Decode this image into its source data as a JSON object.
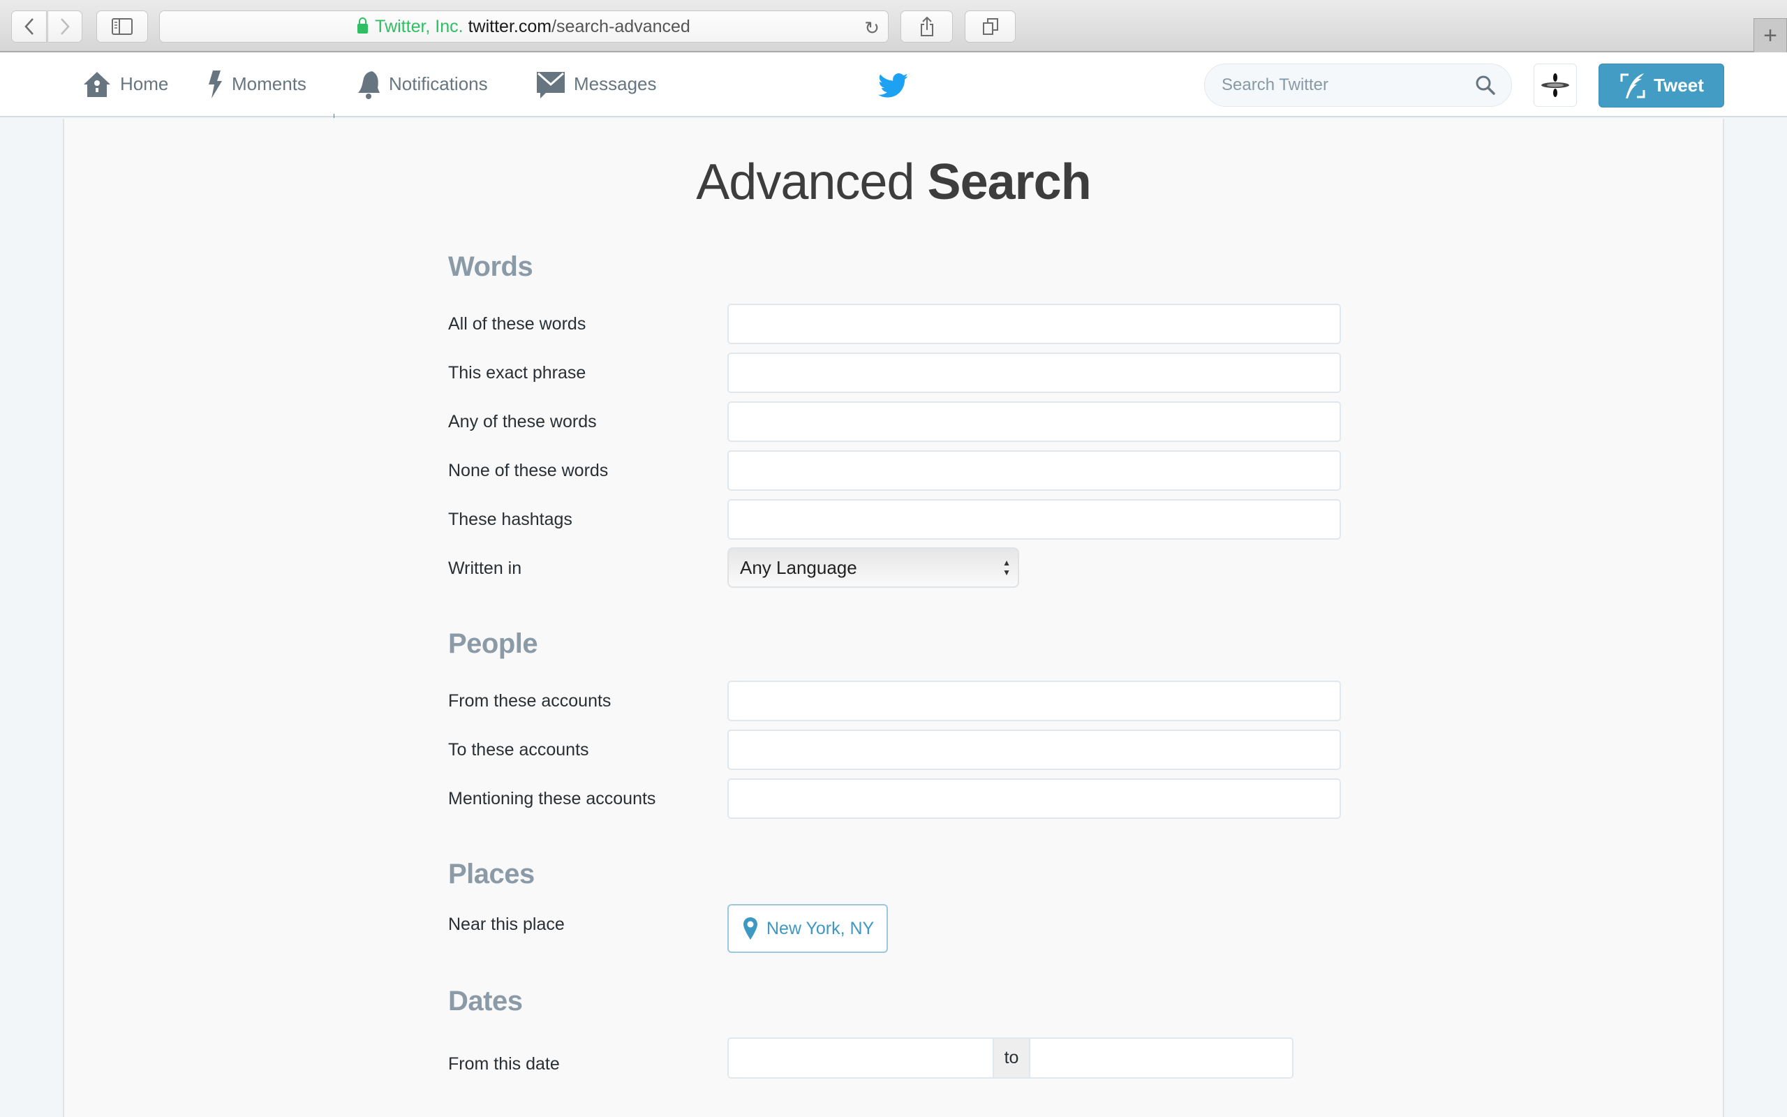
{
  "browser": {
    "address": {
      "org": "Twitter, Inc.",
      "host": "twitter.com",
      "path": "/search-advanced"
    },
    "icons": {
      "back": "chevron-left-icon",
      "forward": "chevron-right-icon",
      "sidebar": "sidebar-icon",
      "reload": "reload-icon",
      "share": "share-icon",
      "tabs": "tabs-icon",
      "new_tab": "plus-icon"
    },
    "reload_glyph": "↻",
    "new_tab_glyph": "+"
  },
  "nav": {
    "items": [
      {
        "label": "Home",
        "icon": "home-icon"
      },
      {
        "label": "Moments",
        "icon": "lightning-icon"
      },
      {
        "label": "Notifications",
        "icon": "bell-icon"
      },
      {
        "label": "Messages",
        "icon": "envelope-icon"
      }
    ],
    "logo": "twitter-bird-icon",
    "search_placeholder": "Search Twitter",
    "tweet_label": "Tweet",
    "colors": {
      "bird": "#1da1f2",
      "tweet_button": "#429cc4",
      "nav_text": "#66757f"
    }
  },
  "page": {
    "title_light": "Advanced",
    "title_bold": "Search",
    "sections": {
      "words": {
        "heading": "Words",
        "fields": [
          {
            "label": "All of these words",
            "value": ""
          },
          {
            "label": "This exact phrase",
            "value": ""
          },
          {
            "label": "Any of these words",
            "value": ""
          },
          {
            "label": "None of these words",
            "value": ""
          },
          {
            "label": "These hashtags",
            "value": ""
          }
        ],
        "language_label": "Written in",
        "language_selected": "Any Language"
      },
      "people": {
        "heading": "People",
        "fields": [
          {
            "label": "From these accounts",
            "value": ""
          },
          {
            "label": "To these accounts",
            "value": ""
          },
          {
            "label": "Mentioning these accounts",
            "value": ""
          }
        ]
      },
      "places": {
        "heading": "Places",
        "near_label": "Near this place",
        "near_value": "New York, NY"
      },
      "dates": {
        "heading": "Dates",
        "from_label": "From this date",
        "separator": "to",
        "from_value": "",
        "to_value": ""
      }
    },
    "colors": {
      "section_heading": "#8b9aa7",
      "place_accent": "#3e99c2"
    }
  }
}
